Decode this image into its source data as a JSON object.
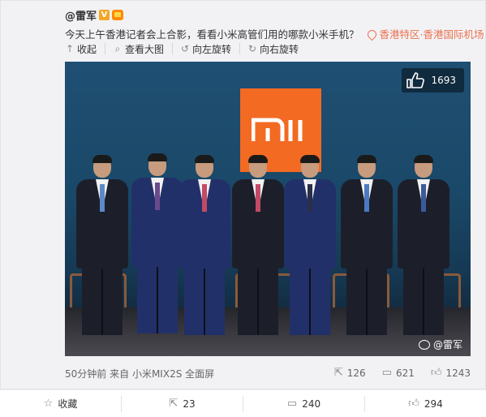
{
  "post": {
    "username": "@雷军",
    "vip_badge": "V",
    "text": "今天上午香港记者会上合影，看看小米高管们用的哪款小米手机？",
    "location": "香港特区·香港国际机场"
  },
  "toolbar": {
    "collapse": "收起",
    "view_large": "查看大图",
    "rotate_left": "向左旋转",
    "rotate_right": "向右旋转"
  },
  "image": {
    "like_count": "1693",
    "watermark": "@雷军",
    "logo_text": "mi",
    "accent_color": "#f36a22"
  },
  "meta": {
    "time": "50分钟前",
    "from_label": "来自",
    "device": "小米MIX2S 全面屏"
  },
  "image_stats": {
    "reposts": "126",
    "comments": "621",
    "likes": "1243"
  },
  "actions": {
    "favorite": "收藏",
    "repost": "23",
    "comment": "240",
    "like": "294"
  },
  "icons": [
    "arrow-up-icon",
    "search-icon",
    "rotate-left-icon",
    "rotate-right-icon",
    "location-icon",
    "thumbs-up-icon",
    "repost-icon",
    "comment-icon",
    "star-icon",
    "weibo-logo-icon"
  ]
}
